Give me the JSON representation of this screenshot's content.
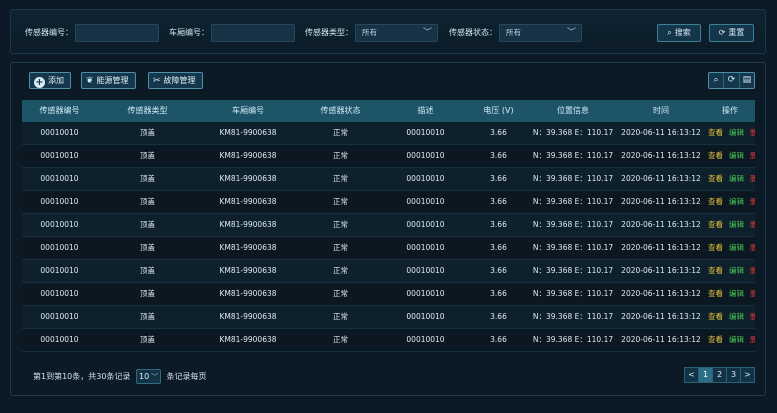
{
  "filters": {
    "sensor_no_label": "传感器编号：",
    "car_no_label": "车厢编号：",
    "sensor_type_label": "传感器类型：",
    "sensor_type_value": "所有",
    "sensor_status_label": "传感器状态：",
    "sensor_status_value": "所有",
    "search_label": "搜索",
    "reset_label": "重置"
  },
  "toolbar": {
    "add_label": "添加",
    "energy_label": "能源管理",
    "fault_label": "故障管理"
  },
  "table": {
    "columns": [
      "传感器编号",
      "传感器类型",
      "车厢编号",
      "传感器状态",
      "描述",
      "电压 (V)",
      "位置信息",
      "时间",
      "操作"
    ],
    "rows": [
      {
        "id": "00010010",
        "type": "顶盖",
        "car": "KM81-9900638",
        "status": "正常",
        "desc": "00010010",
        "voltage": "3.66",
        "pos": "N：39.368 E：110.17",
        "time": "2020-06-11 16:13:12",
        "view": "查看",
        "edit": "编辑",
        "del": "删除"
      },
      {
        "id": "00010010",
        "type": "顶盖",
        "car": "KM81-9900638",
        "status": "正常",
        "desc": "00010010",
        "voltage": "3.66",
        "pos": "N：39.368 E：110.17",
        "time": "2020-06-11 16:13:12",
        "view": "查看",
        "edit": "编辑",
        "del": "删除"
      },
      {
        "id": "00010010",
        "type": "顶盖",
        "car": "KM81-9900638",
        "status": "正常",
        "desc": "00010010",
        "voltage": "3.66",
        "pos": "N：39.368 E：110.17",
        "time": "2020-06-11 16:13:12",
        "view": "查看",
        "edit": "编辑",
        "del": "删除"
      },
      {
        "id": "00010010",
        "type": "顶盖",
        "car": "KM81-9900638",
        "status": "正常",
        "desc": "00010010",
        "voltage": "3.66",
        "pos": "N：39.368 E：110.17",
        "time": "2020-06-11 16:13:12",
        "view": "查看",
        "edit": "编辑",
        "del": "删除"
      },
      {
        "id": "00010010",
        "type": "顶盖",
        "car": "KM81-9900638",
        "status": "正常",
        "desc": "00010010",
        "voltage": "3.66",
        "pos": "N：39.368 E：110.17",
        "time": "2020-06-11 16:13:12",
        "view": "查看",
        "edit": "编辑",
        "del": "删除"
      },
      {
        "id": "00010010",
        "type": "顶盖",
        "car": "KM81-9900638",
        "status": "正常",
        "desc": "00010010",
        "voltage": "3.66",
        "pos": "N：39.368 E：110.17",
        "time": "2020-06-11 16:13:12",
        "view": "查看",
        "edit": "编辑",
        "del": "删除"
      },
      {
        "id": "00010010",
        "type": "顶盖",
        "car": "KM81-9900638",
        "status": "正常",
        "desc": "00010010",
        "voltage": "3.66",
        "pos": "N：39.368 E：110.17",
        "time": "2020-06-11 16:13:12",
        "view": "查看",
        "edit": "编辑",
        "del": "删除"
      },
      {
        "id": "00010010",
        "type": "顶盖",
        "car": "KM81-9900638",
        "status": "正常",
        "desc": "00010010",
        "voltage": "3.66",
        "pos": "N：39.368 E：110.17",
        "time": "2020-06-11 16:13:12",
        "view": "查看",
        "edit": "编辑",
        "del": "删除"
      },
      {
        "id": "00010010",
        "type": "顶盖",
        "car": "KM81-9900638",
        "status": "正常",
        "desc": "00010010",
        "voltage": "3.66",
        "pos": "N：39.368 E：110.17",
        "time": "2020-06-11 16:13:12",
        "view": "查看",
        "edit": "编辑",
        "del": "删除"
      },
      {
        "id": "00010010",
        "type": "顶盖",
        "car": "KM81-9900638",
        "status": "正常",
        "desc": "00010010",
        "voltage": "3.66",
        "pos": "N：39.368 E：110.17",
        "time": "2020-06-11 16:13:12",
        "view": "查看",
        "edit": "编辑",
        "del": "删除"
      }
    ]
  },
  "pager": {
    "info_prefix": "第1到第10条，共30条记录",
    "page_size": "10",
    "info_suffix": "条记录每页",
    "prev": "<",
    "pages": [
      "1",
      "2",
      "3"
    ],
    "next": ">"
  },
  "colors": {
    "background": "#0b1a26",
    "header_row": "#1d5468",
    "view_action": "#e8c33c",
    "edit_action": "#46c653",
    "delete_action": "#e0373a"
  },
  "icons": {
    "select_chevron": "chevron-down-icon",
    "search": "search-icon",
    "reset": "refresh-icon",
    "add": "plus-circle-icon",
    "energy": "leaf-icon",
    "fault": "tools-icon",
    "toolbar_search": "search-icon",
    "toolbar_refresh": "refresh-icon",
    "toolbar_export": "export-icon"
  }
}
